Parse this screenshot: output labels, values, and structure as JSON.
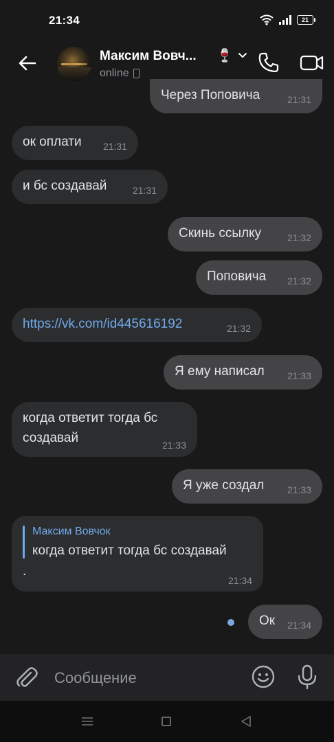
{
  "status_bar": {
    "time": "21:34",
    "battery": "21"
  },
  "header": {
    "name": "Максим Вовч...",
    "emoji": "🍷",
    "status": "online"
  },
  "messages": [
    {
      "dir": "out",
      "text": "Через Поповича",
      "time": "21:31"
    },
    {
      "dir": "in",
      "text": "ок оплати",
      "time": "21:31"
    },
    {
      "dir": "in",
      "text": "и бс создавай",
      "time": "21:31"
    },
    {
      "dir": "out",
      "text": "Скинь ссылку",
      "time": "21:32"
    },
    {
      "dir": "out",
      "text": "Поповича",
      "time": "21:32"
    },
    {
      "dir": "in",
      "text": "https://vk.com/id445616192",
      "time": "21:32"
    },
    {
      "dir": "out",
      "text": "Я ему написал",
      "time": "21:33"
    },
    {
      "dir": "in",
      "text": "когда ответит тогда бс создавай",
      "time": "21:33"
    },
    {
      "dir": "out",
      "text": "Я уже создал",
      "time": "21:33"
    },
    {
      "dir": "in",
      "reply_name": "Максим Вовчок",
      "reply_text": "когда ответит тогда бс создавай",
      "text": ".",
      "time": "21:34"
    },
    {
      "dir": "out",
      "text": "Ок",
      "time": "21:34"
    }
  ],
  "input": {
    "placeholder": "Сообщение"
  },
  "icons": {
    "back": "arrow-left-icon",
    "call": "phone-icon",
    "video": "video-camera-icon",
    "attach": "paperclip-icon",
    "emoji": "smile-icon",
    "mic": "microphone-icon"
  },
  "colors": {
    "background": "#19191a",
    "bubble_out": "#444446",
    "bubble_in": "#2c2d2f",
    "link": "#71aaeb"
  }
}
